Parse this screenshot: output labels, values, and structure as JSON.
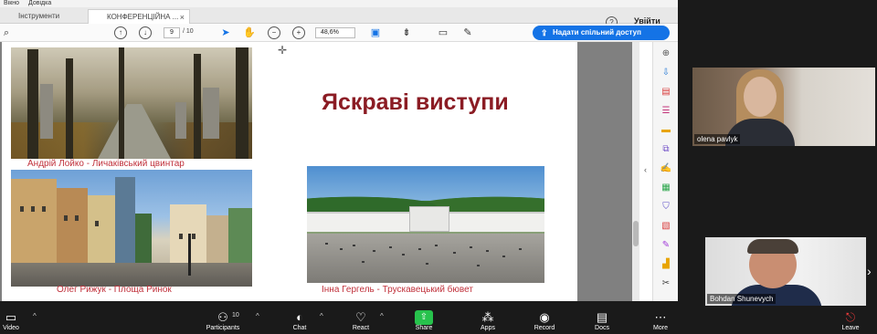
{
  "menubar": {
    "items": [
      "Вікно",
      "Довідка"
    ]
  },
  "tabs": [
    {
      "label": "Інструменти"
    },
    {
      "label": "КОНФЕРЕНЦІЙНА ..."
    }
  ],
  "header": {
    "help": "?",
    "signin": "Увійти"
  },
  "toolbar": {
    "page_current": "9",
    "page_total": "/ 10",
    "zoom": "48,6%",
    "share_button": "Надати спільний доступ"
  },
  "slide": {
    "title": "Яскраві виступи",
    "captions": [
      "Андрій Лойко - Личаківський цвинтар",
      "Олег Рижук - Площа Ринок",
      "Інна Гергель - Трускавецький бювет"
    ]
  },
  "participants": [
    {
      "name": "olena pavlyk"
    },
    {
      "name": "Bohdan Shunevych"
    }
  ],
  "controls": {
    "video": "Video",
    "participants": "Participants",
    "participant_count": "10",
    "chat": "Chat",
    "react": "React",
    "share": "Share",
    "apps": "Apps",
    "record": "Record",
    "docs": "Docs",
    "more": "More",
    "leave": "Leave"
  },
  "icons": {
    "toolbar": [
      "search-icon",
      "page-up-icon",
      "page-down-icon",
      "select-arrow-icon",
      "hand-icon",
      "zoom-out-icon",
      "zoom-in-icon",
      "fit-page-icon",
      "scroll-mode-icon",
      "comment-icon",
      "pen-icon",
      "share-icon"
    ],
    "rail": [
      "zoom-icon",
      "export-pdf-icon",
      "create-pdf-icon",
      "edit-pdf-icon",
      "comment-icon",
      "combine-icon",
      "fill-sign-icon",
      "organize-icon",
      "protect-icon",
      "redact-icon",
      "measure-icon",
      "stamp-icon",
      "more-tools-icon"
    ],
    "colors": {
      "title": "#8b1c24",
      "caption": "#c0313b",
      "share_blue": "#1473e6",
      "share_green": "#27c24c",
      "leave_red": "#e23a3a"
    }
  }
}
